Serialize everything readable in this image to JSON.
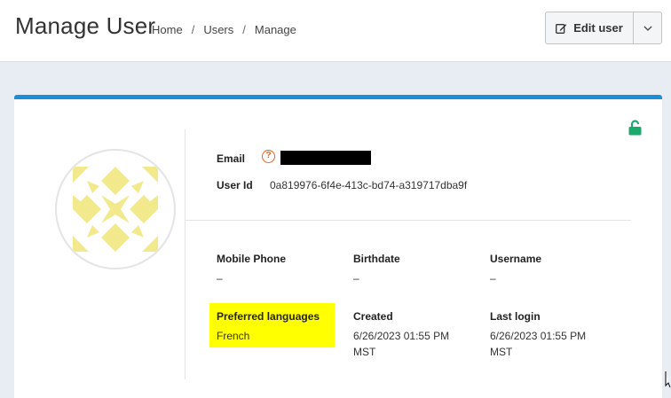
{
  "header": {
    "title": "Manage User",
    "breadcrumbs": [
      "Home",
      "Users",
      "Manage"
    ],
    "breadcrumb_separator": "/",
    "edit_button_label": "Edit user"
  },
  "profile": {
    "email_label": "Email",
    "email_value": "[redacted]",
    "user_id_label": "User Id",
    "user_id_value": "0a819976-6f4e-413c-bd74-a319717dba9f",
    "fields": [
      {
        "label": "Mobile Phone",
        "value": "–"
      },
      {
        "label": "Birthdate",
        "value": "–"
      },
      {
        "label": "Username",
        "value": "–"
      },
      {
        "label": "Preferred languages",
        "value": "French"
      },
      {
        "label": "Created",
        "value": "6/26/2023 01:55 PM MST"
      },
      {
        "label": "Last login",
        "value": "6/26/2023 01:55 PM MST"
      }
    ]
  },
  "icons": {
    "edit": "pencil-square-icon",
    "caret": "chevron-down-icon",
    "lock": "unlock-icon",
    "help": "question-circle-icon"
  },
  "colors": {
    "accent": "#1a8ed6",
    "lock": "#1aaa6e",
    "help": "#e8601c",
    "highlight": "#ffff00",
    "avatar_pattern": "#f1e98c"
  }
}
